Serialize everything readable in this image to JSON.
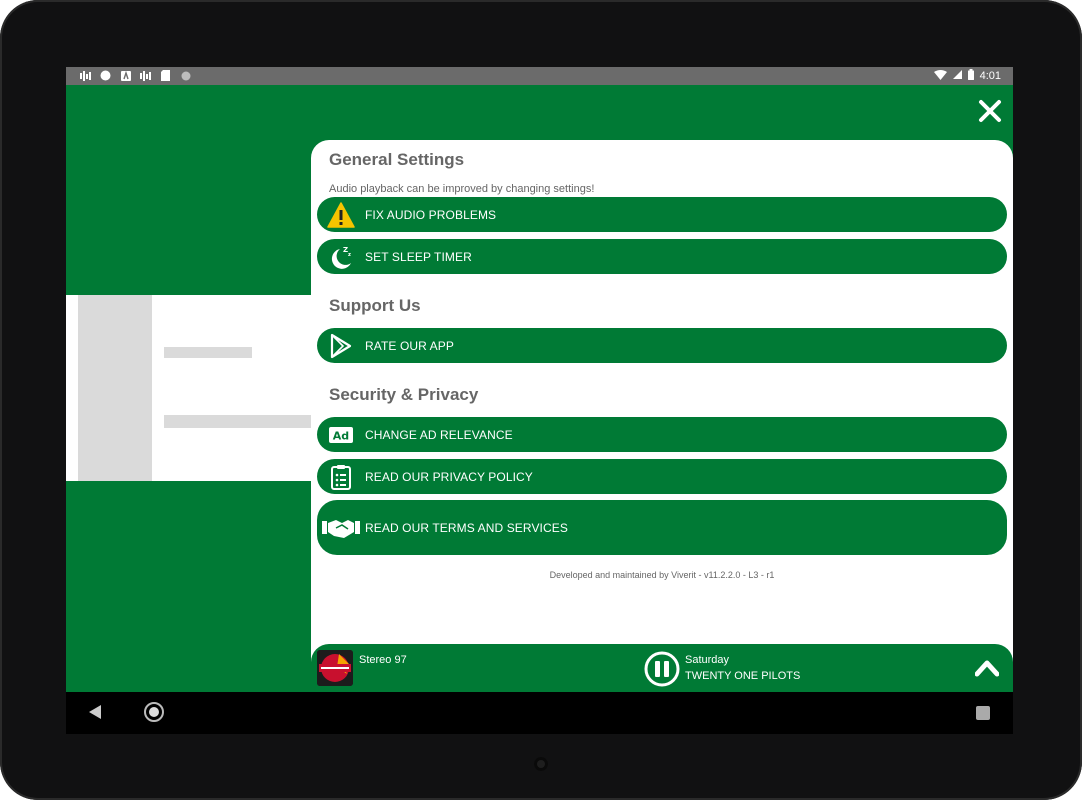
{
  "status": {
    "time": "4:01"
  },
  "settings": {
    "general": {
      "title": "General Settings",
      "subtitle": "Audio playback can be improved by changing settings!",
      "fix_audio": "FIX AUDIO PROBLEMS",
      "sleep_timer": "SET SLEEP TIMER"
    },
    "support": {
      "title": "Support Us",
      "rate_app": "RATE OUR APP"
    },
    "privacy": {
      "title": "Security & Privacy",
      "ad_relevance": "CHANGE AD RELEVANCE",
      "privacy_policy": "READ OUR PRIVACY POLICY",
      "terms": "READ OUR TERMS AND SERVICES"
    },
    "footer": "Developed and maintained by Viverit - v11.2.2.0 - L3 - r1"
  },
  "player": {
    "station": "Stereo 97",
    "track_title": "Saturday",
    "track_artist": "TWENTY ONE PILOTS"
  },
  "colors": {
    "primary": "#007a35",
    "text_muted": "#666666",
    "warning": "#f5c400"
  },
  "icons": [
    "close-icon",
    "warning-icon",
    "sleep-icon",
    "play-store-icon",
    "ad-icon",
    "clipboard-icon",
    "handshake-icon",
    "pause-icon",
    "chevron-up-icon"
  ]
}
